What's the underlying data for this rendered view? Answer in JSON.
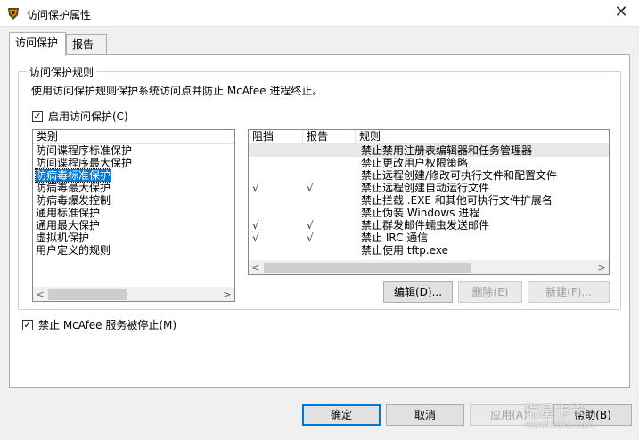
{
  "window": {
    "title": "访问保护属性"
  },
  "tabs": [
    {
      "label": "访问保护"
    },
    {
      "label": "报告"
    }
  ],
  "group": {
    "title": "访问保护规则",
    "description": "使用访问保护规则保护系统访问点并防止 McAfee 进程终止。",
    "enable_label": "启用访问保护(C)",
    "enable_checked": true
  },
  "categories": {
    "header": "类别",
    "items": [
      "防间谍程序标准保护",
      "防间谍程序最大保护",
      "防病毒标准保护",
      "防病毒最大保护",
      "防病毒爆发控制",
      "通用标准保护",
      "通用最大保护",
      "虚拟机保护",
      "用户定义的规则"
    ],
    "selected_index": 2
  },
  "rules": {
    "headers": {
      "block": "阻挡",
      "report": "报告",
      "rule": "规则"
    },
    "rows": [
      {
        "block": "",
        "report": "",
        "rule": "禁止禁用注册表编辑器和任务管理器"
      },
      {
        "block": "",
        "report": "",
        "rule": "禁止更改用户权限策略"
      },
      {
        "block": "",
        "report": "",
        "rule": "禁止远程创建/修改可执行文件和配置文件"
      },
      {
        "block": "√",
        "report": "√",
        "rule": "禁止远程创建自动运行文件"
      },
      {
        "block": "",
        "report": "",
        "rule": "禁止拦截 .EXE 和其他可执行文件扩展名"
      },
      {
        "block": "",
        "report": "",
        "rule": "禁止伪装 Windows 进程"
      },
      {
        "block": "√",
        "report": "√",
        "rule": "禁止群发邮件蠕虫发送邮件"
      },
      {
        "block": "√",
        "report": "√",
        "rule": "禁止 IRC 通信"
      },
      {
        "block": "",
        "report": "",
        "rule": "禁止使用 tftp.exe"
      }
    ]
  },
  "rule_buttons": {
    "edit": "编辑(D)...",
    "delete": "删除(E)",
    "new": "新建(F)..."
  },
  "stop_service": {
    "label": "禁止 McAfee 服务被停止(M)",
    "checked": true
  },
  "footer": {
    "ok": "确定",
    "cancel": "取消",
    "apply": "应用(A)",
    "help": "帮助(B)"
  },
  "watermark": {
    "text1": "瑞星卡卡",
    "text2": "www.ikaka.com"
  }
}
